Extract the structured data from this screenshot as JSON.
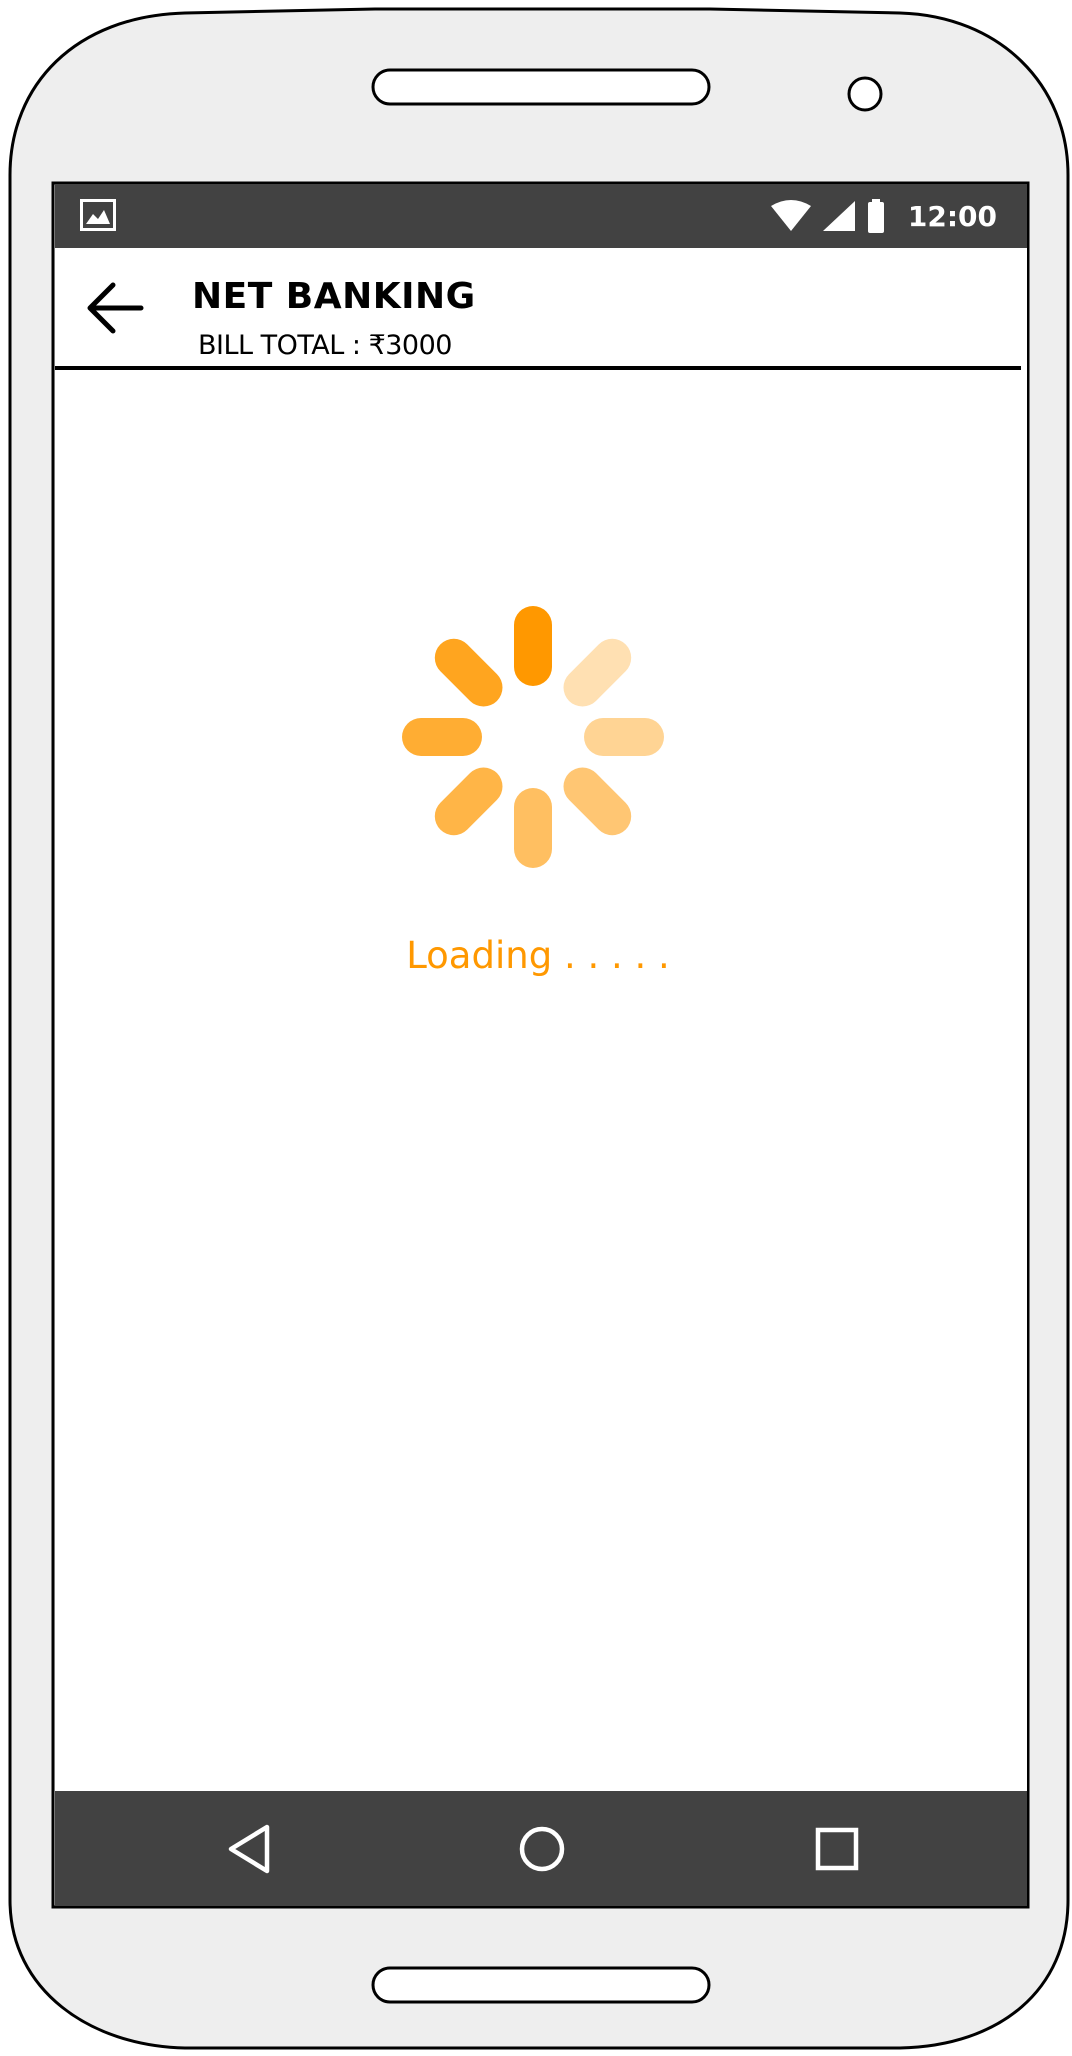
{
  "status_bar": {
    "time": "12:00",
    "icons": [
      "image-icon",
      "wifi-icon",
      "signal-icon",
      "battery-icon"
    ]
  },
  "app_bar": {
    "title": "NET BANKING",
    "subtitle": "BILL TOTAL : ₹3000",
    "back_icon": "arrow-left-icon"
  },
  "content": {
    "loading_text": "Loading . . . . .",
    "spinner_color": "#ff9800"
  },
  "nav_bar": {
    "icons": [
      "back-triangle-icon",
      "home-circle-icon",
      "recents-square-icon"
    ]
  },
  "colors": {
    "accent": "#ff9800",
    "system_bars": "#424242",
    "phone_body": "#eeeeee"
  }
}
